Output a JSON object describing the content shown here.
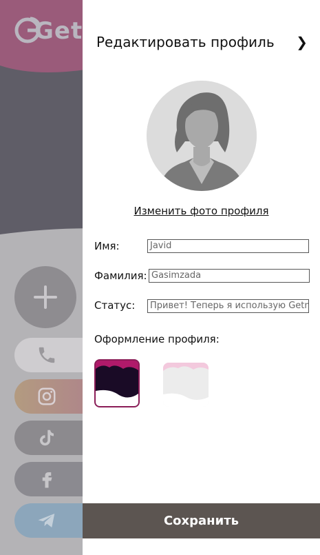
{
  "background": {
    "logo_text": "Getm",
    "add_button": "+",
    "social_icons": [
      "phone-icon",
      "instagram-icon",
      "tiktok-icon",
      "facebook-icon",
      "telegram-icon"
    ]
  },
  "panel": {
    "title": "Редактировать профиль",
    "chevron": "❯",
    "change_photo_label": "Изменить фото профиля",
    "fields": {
      "first_name_label": "Имя:",
      "first_name_value": "Javid",
      "last_name_label": "Фамилия:",
      "last_name_value": "Gasimzada",
      "status_label": "Статус:",
      "status_value": "Привет! Теперь я использую Getm"
    },
    "theme_label": "Оформление профиля:",
    "themes": [
      "dark-pink-theme",
      "light-pink-theme"
    ],
    "selected_theme": "dark-pink-theme",
    "save_label": "Сохранить"
  },
  "colors": {
    "accent": "#8b1c57",
    "save_button": "#5c5551"
  }
}
